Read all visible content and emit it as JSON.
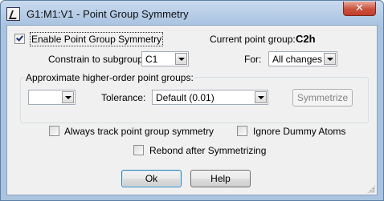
{
  "window": {
    "title": "G1:M1:V1 - Point Group Symmetry",
    "close_glyph": "✕",
    "accent_color": "#aac4e0",
    "close_color": "#c9513c"
  },
  "enable": {
    "label": "Enable Point Group Symmetry",
    "checked": true
  },
  "current_group": {
    "label": "Current point group:",
    "value": "C2h"
  },
  "constrain": {
    "label": "Constrain to subgroup:",
    "selected": "C1"
  },
  "for": {
    "label": "For:",
    "selected": "All changes"
  },
  "approx": {
    "group_label": "Approximate higher-order point groups:",
    "selected": "",
    "tolerance_label": "Tolerance:",
    "tolerance_selected": "Default (0.01)",
    "symmetrize_label": "Symmetrize"
  },
  "options": {
    "always_track": "Always track point group symmetry",
    "ignore_dummy": "Ignore Dummy Atoms",
    "rebond": "Rebond after Symmetrizing"
  },
  "buttons": {
    "ok": "Ok",
    "help": "Help"
  }
}
